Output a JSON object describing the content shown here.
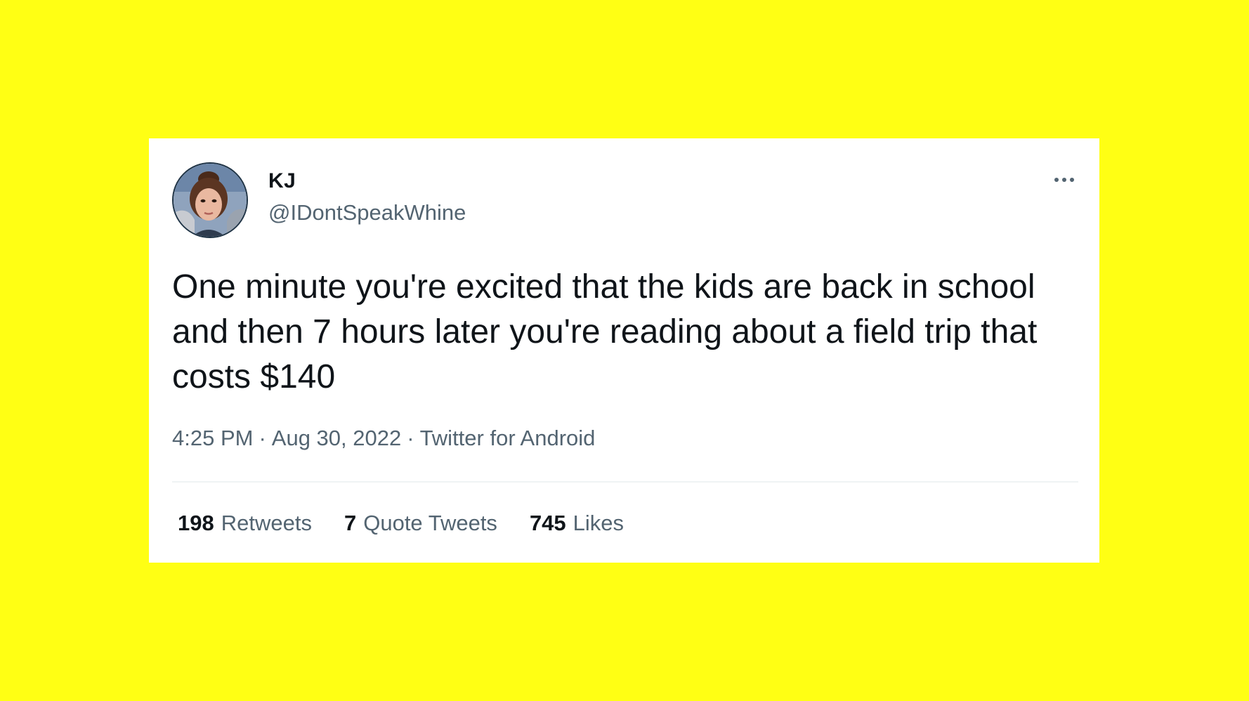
{
  "colors": {
    "background": "#ffff14",
    "card": "#ffffff",
    "text_primary": "#0f1419",
    "text_secondary": "#536471"
  },
  "tweet": {
    "author_name": "KJ",
    "author_handle": "@IDontSpeakWhine",
    "avatar_icon": "user-avatar-photo",
    "more_icon": "more-horizontal-icon",
    "text": "One minute you're excited that the kids are back in school and then 7 hours later you're reading about a field trip that costs $140",
    "time": "4:25 PM",
    "date": "Aug 30, 2022",
    "source": "Twitter for Android",
    "separator": "·",
    "stats": {
      "retweets_count": "198",
      "retweets_label": "Retweets",
      "quotes_count": "7",
      "quotes_label": "Quote Tweets",
      "likes_count": "745",
      "likes_label": "Likes"
    }
  }
}
